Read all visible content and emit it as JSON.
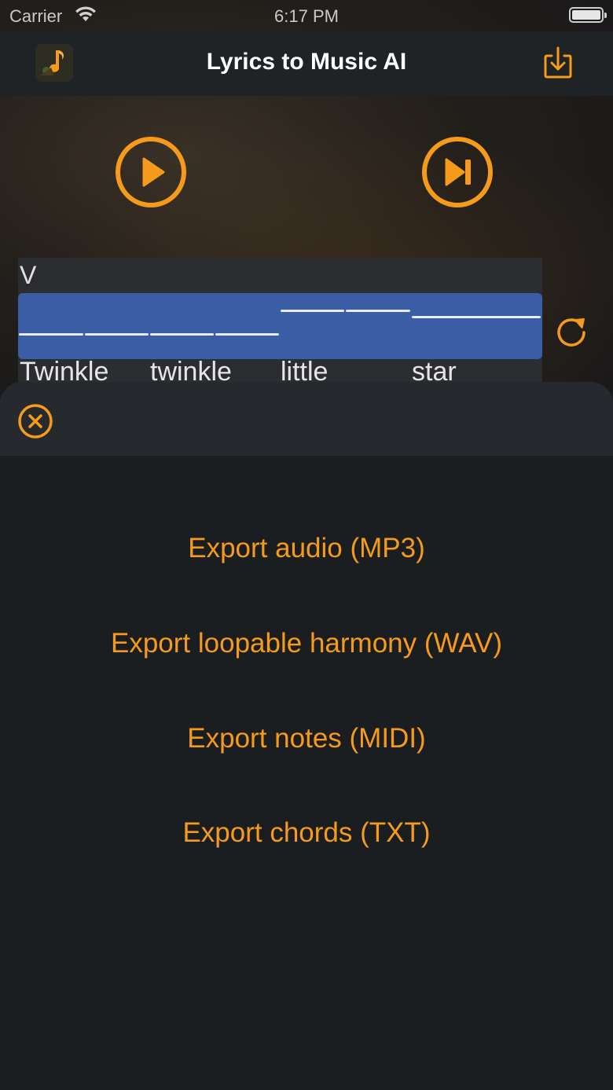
{
  "status_bar": {
    "carrier": "Carrier",
    "time": "6:17 PM"
  },
  "nav": {
    "title": "Lyrics to Music AI",
    "app_icon": "app-logo-icon",
    "download_icon": "download-icon"
  },
  "player": {
    "play_icon": "play-icon",
    "skip_icon": "skip-forward-icon",
    "refresh_icon": "refresh-icon"
  },
  "track": {
    "section_label": "V",
    "lyrics": [
      "Twinkle",
      "twinkle",
      "little",
      "star"
    ]
  },
  "sheet": {
    "close_icon": "close-icon",
    "items": [
      {
        "label": "Export audio (MP3)"
      },
      {
        "label": "Export loopable harmony (WAV)"
      },
      {
        "label": "Export notes (MIDI)"
      },
      {
        "label": "Export chords (TXT)"
      }
    ]
  },
  "colors": {
    "accent": "#f59a1b",
    "notes_bar": "#3a5da6",
    "background": "#1b1e21"
  }
}
